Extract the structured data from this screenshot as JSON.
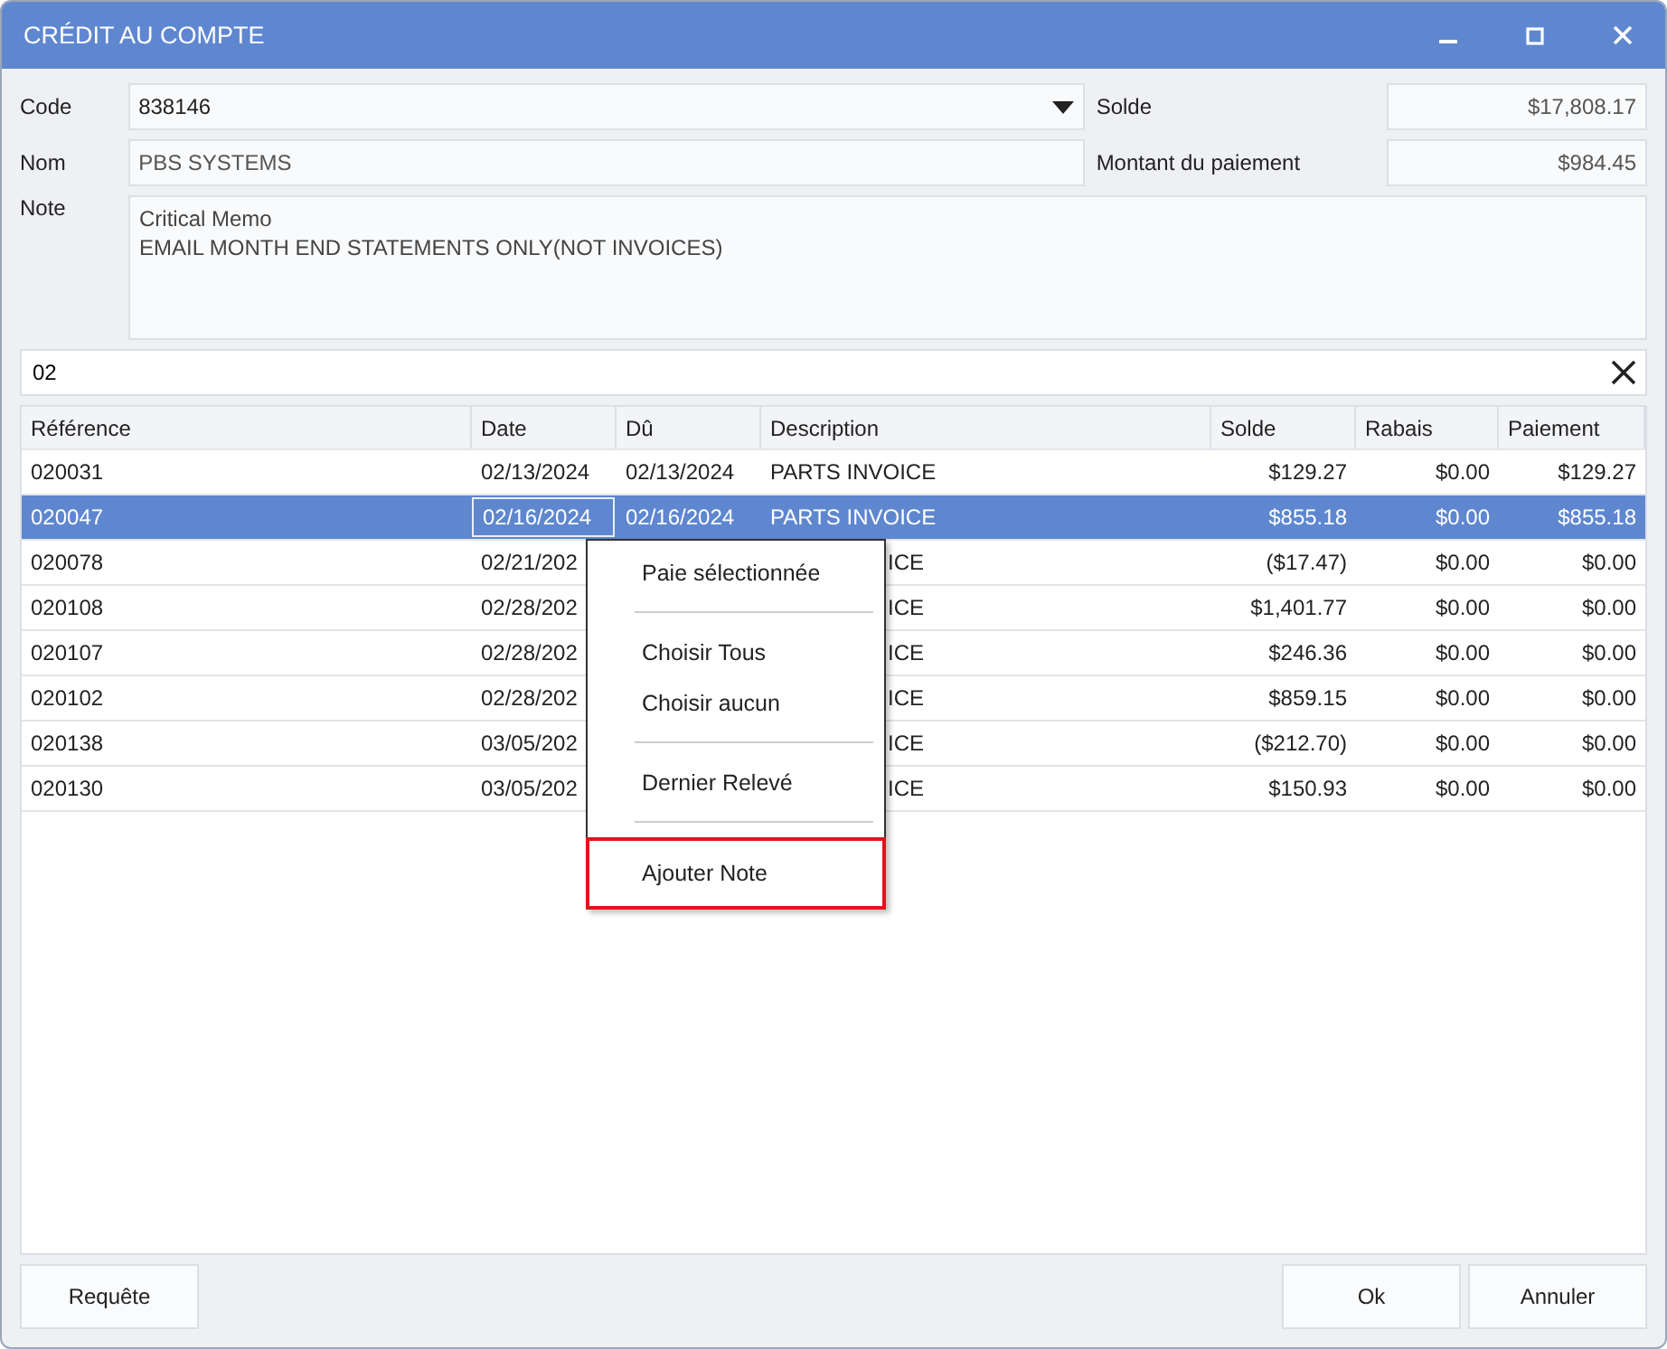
{
  "window": {
    "title": "CRÉDIT AU COMPTE"
  },
  "fields": [
    {
      "label": "Code",
      "value": "838146",
      "kind": "dropdown"
    },
    {
      "label": "Nom",
      "value": "PBS SYSTEMS",
      "kind": "readonly"
    }
  ],
  "totals": [
    {
      "label": "Solde",
      "value": "$17,808.17"
    },
    {
      "label": "Montant du paiement",
      "value": "$984.45"
    }
  ],
  "note": {
    "label": "Note",
    "lines": [
      "Critical Memo",
      "EMAIL MONTH END STATEMENTS ONLY(NOT INVOICES)"
    ]
  },
  "filter": {
    "value": "02"
  },
  "table": {
    "columns": [
      "Référence",
      "Date",
      "Dû",
      "Description",
      "Solde",
      "Rabais",
      "Paiement"
    ],
    "rows": [
      {
        "selected": false,
        "kind": "full",
        "cells": [
          "020031",
          "02/13/2024",
          "02/13/2024",
          "PARTS INVOICE",
          "$129.27",
          "$0.00",
          "$129.27"
        ]
      },
      {
        "selected": true,
        "kind": "full",
        "cells": [
          "020047",
          "02/16/2024",
          "02/16/2024",
          "PARTS INVOICE",
          "$855.18",
          "$0.00",
          "$855.18"
        ]
      },
      {
        "selected": false,
        "kind": "partial",
        "cells": [
          "020078",
          "02/21/202",
          "",
          "ICE",
          "($17.47)",
          "$0.00",
          "$0.00"
        ]
      },
      {
        "selected": false,
        "kind": "partial",
        "cells": [
          "020108",
          "02/28/202",
          "",
          "ICE",
          "$1,401.77",
          "$0.00",
          "$0.00"
        ]
      },
      {
        "selected": false,
        "kind": "partial",
        "cells": [
          "020107",
          "02/28/202",
          "",
          "ICE",
          "$246.36",
          "$0.00",
          "$0.00"
        ]
      },
      {
        "selected": false,
        "kind": "partial",
        "cells": [
          "020102",
          "02/28/202",
          "",
          "ICE",
          "$859.15",
          "$0.00",
          "$0.00"
        ]
      },
      {
        "selected": false,
        "kind": "partial",
        "cells": [
          "020138",
          "03/05/202",
          "",
          "ICE",
          "($212.70)",
          "$0.00",
          "$0.00"
        ]
      },
      {
        "selected": false,
        "kind": "partial",
        "cells": [
          "020130",
          "03/05/202",
          "",
          "ICE",
          "$150.93",
          "$0.00",
          "$0.00"
        ]
      }
    ]
  },
  "context_menu": {
    "items": [
      {
        "kind": "item",
        "label": "Paie sélectionnée",
        "highlighted": false
      },
      {
        "kind": "separator"
      },
      {
        "kind": "item",
        "label": "Choisir Tous",
        "highlighted": false
      },
      {
        "kind": "item",
        "label": "Choisir aucun",
        "highlighted": false
      },
      {
        "kind": "separator"
      },
      {
        "kind": "item",
        "label": "Dernier Relevé",
        "highlighted": false
      },
      {
        "kind": "separator"
      },
      {
        "kind": "item",
        "label": "Ajouter Note",
        "highlighted": true
      }
    ]
  },
  "buttons_left": [
    "Requête"
  ],
  "buttons_right": [
    "Ok",
    "Annuler"
  ]
}
